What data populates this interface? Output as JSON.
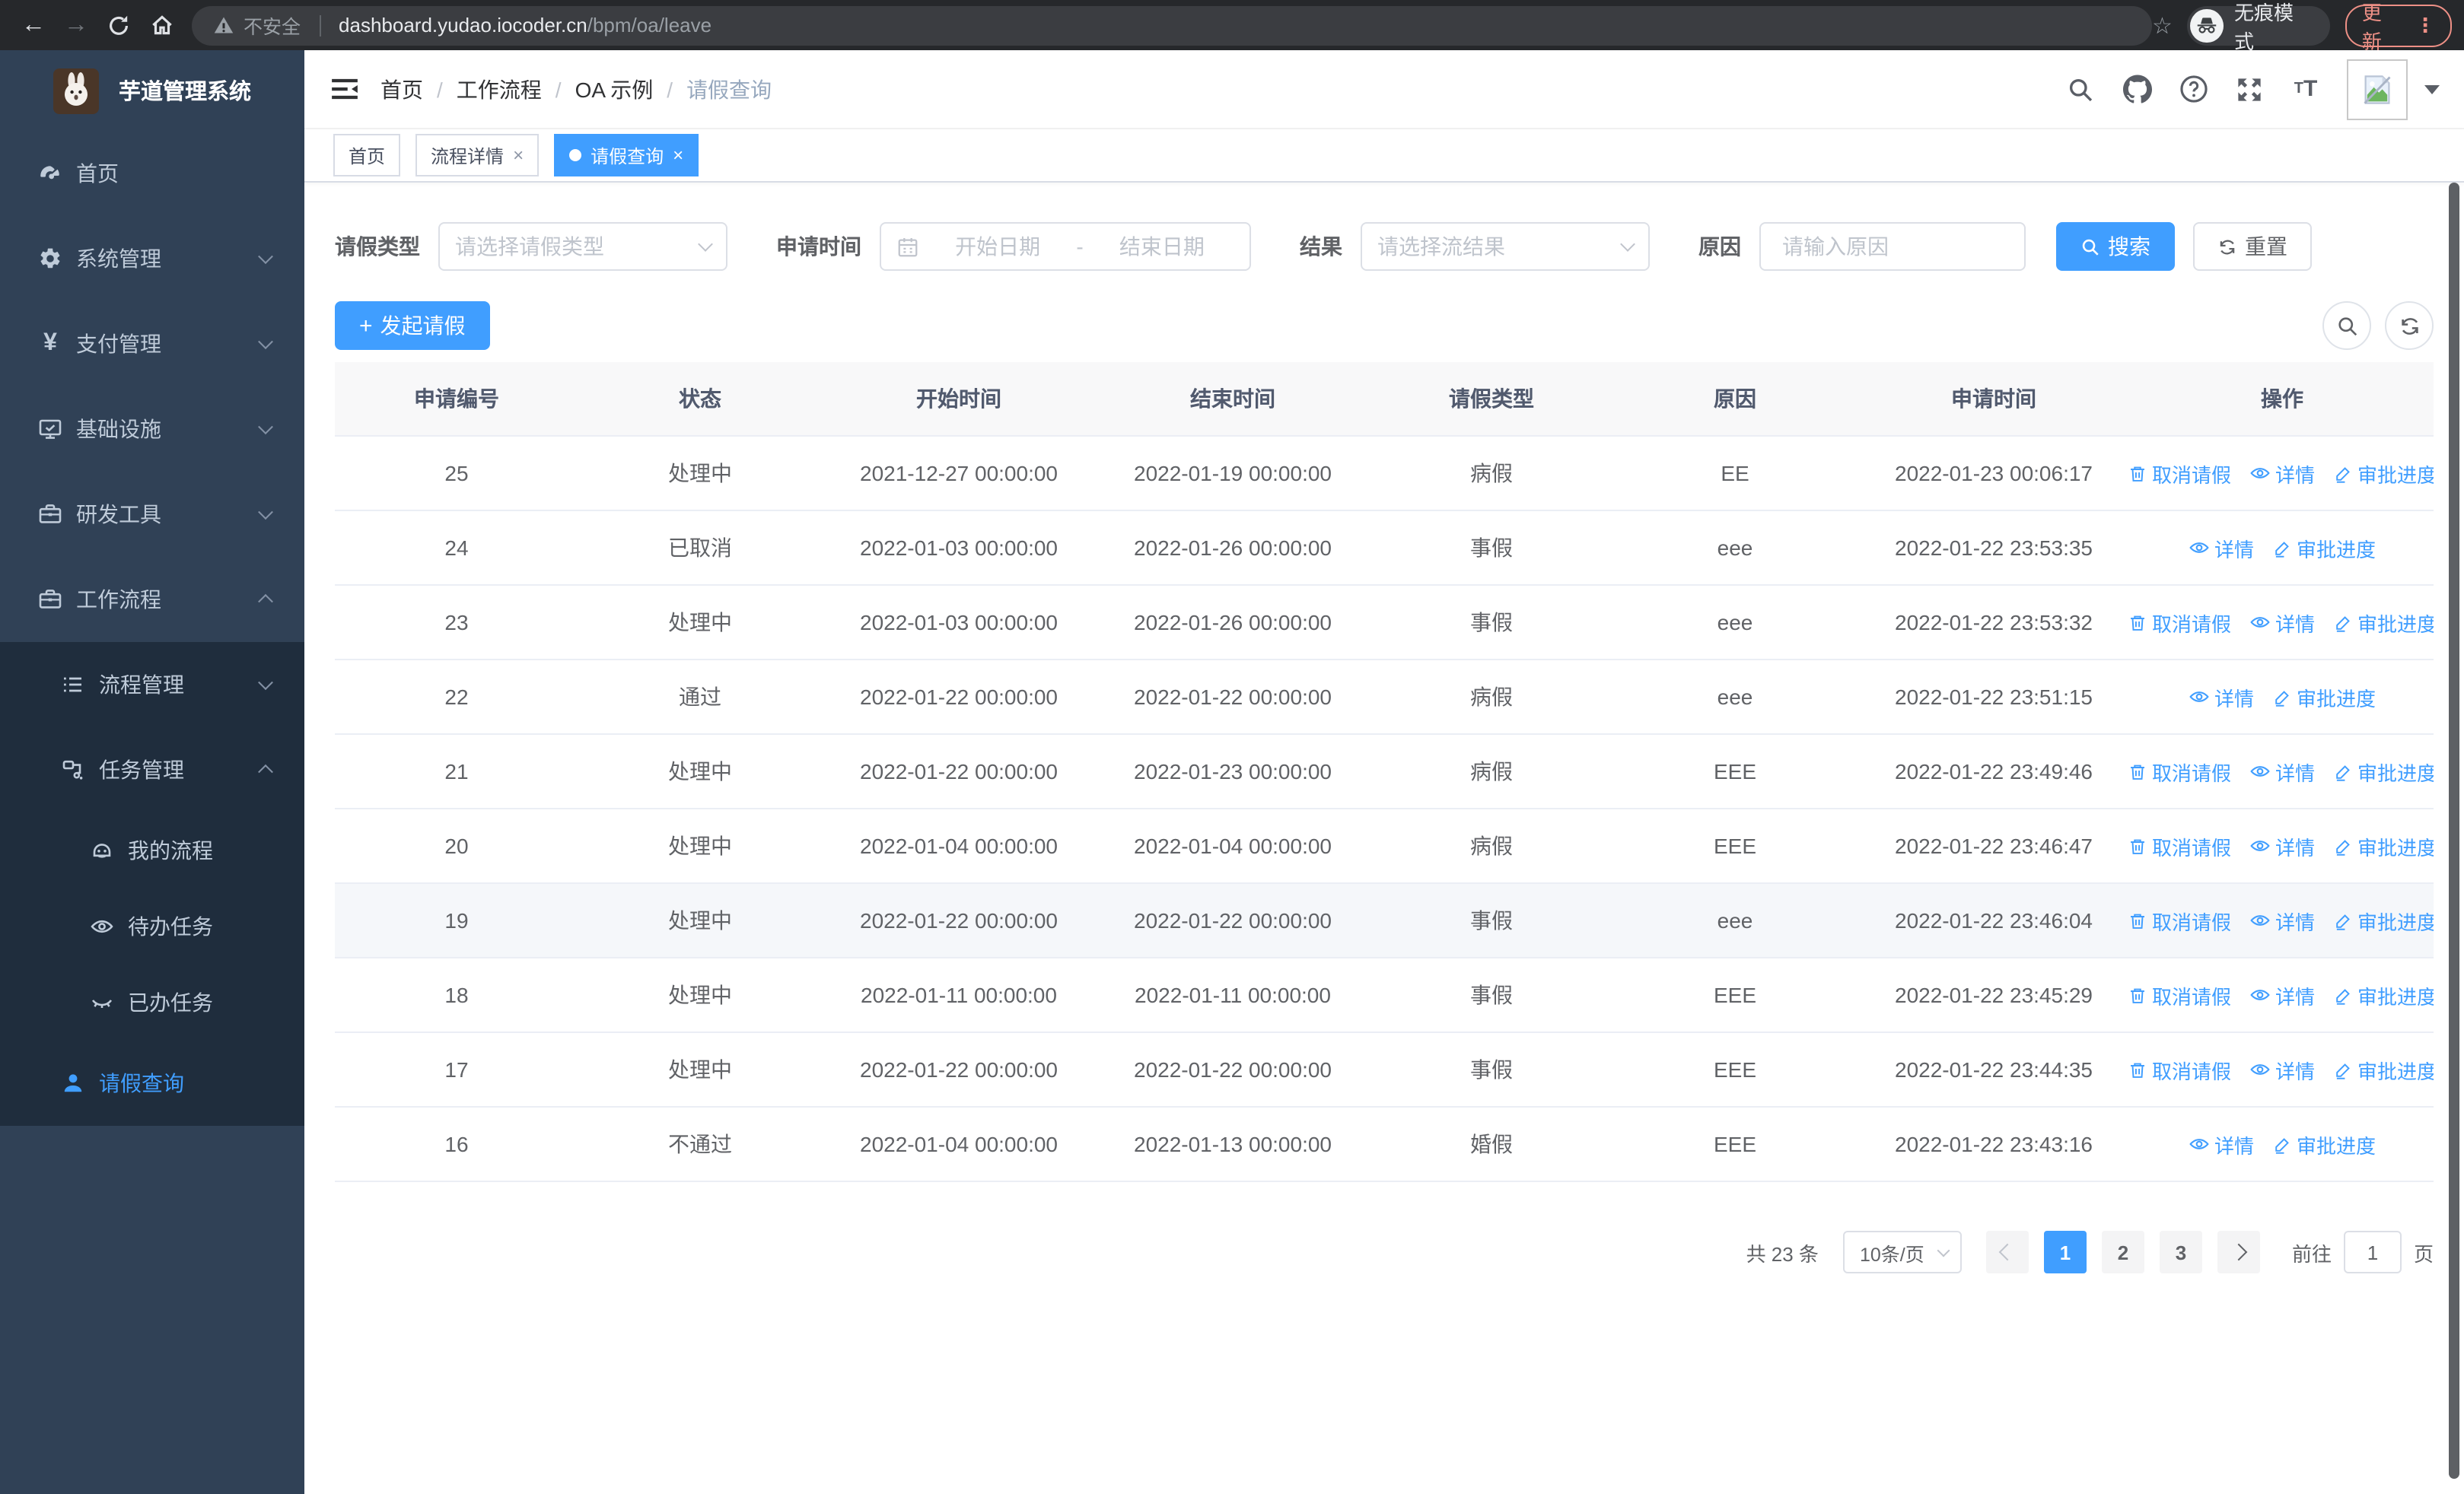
{
  "browser": {
    "security_label": "不安全",
    "url_host": "dashboard.yudao.iocoder.cn",
    "url_path": "/bpm/oa/leave",
    "incognito_label": "无痕模式",
    "update_label": "更新"
  },
  "sidebar": {
    "title": "芋道管理系统",
    "home": "首页",
    "system": "系统管理",
    "payment": "支付管理",
    "infra": "基础设施",
    "devtools": "研发工具",
    "workflow": "工作流程",
    "process_mgmt": "流程管理",
    "task_mgmt": "任务管理",
    "my_process": "我的流程",
    "todo_task": "待办任务",
    "done_task": "已办任务",
    "leave_query": "请假查询"
  },
  "navbar": {
    "breadcrumb": [
      "首页",
      "工作流程",
      "OA 示例",
      "请假查询"
    ]
  },
  "tags": {
    "t1": "首页",
    "t2": "流程详情",
    "t3": "请假查询",
    "close": "×"
  },
  "filters": {
    "type_label": "请假类型",
    "type_placeholder": "请选择请假类型",
    "time_label": "申请时间",
    "start_placeholder": "开始日期",
    "range_separator": "-",
    "end_placeholder": "结束日期",
    "result_label": "结果",
    "result_placeholder": "请选择流结果",
    "reason_label": "原因",
    "reason_placeholder": "请输入原因",
    "search_label": "搜索",
    "reset_label": "重置"
  },
  "toolbar": {
    "create_label": "发起请假"
  },
  "table": {
    "columns": [
      "申请编号",
      "状态",
      "开始时间",
      "结束时间",
      "请假类型",
      "原因",
      "申请时间",
      "操作"
    ],
    "actions": {
      "cancel": "取消请假",
      "detail": "详情",
      "progress": "审批进度"
    },
    "rows": [
      {
        "id": "25",
        "status": "处理中",
        "start": "2021-12-27 00:00:00",
        "end": "2022-01-19 00:00:00",
        "type": "病假",
        "reason": "EE",
        "applied": "2022-01-23 00:06:17",
        "cancellable": true
      },
      {
        "id": "24",
        "status": "已取消",
        "start": "2022-01-03 00:00:00",
        "end": "2022-01-26 00:00:00",
        "type": "事假",
        "reason": "eee",
        "applied": "2022-01-22 23:53:35",
        "cancellable": false
      },
      {
        "id": "23",
        "status": "处理中",
        "start": "2022-01-03 00:00:00",
        "end": "2022-01-26 00:00:00",
        "type": "事假",
        "reason": "eee",
        "applied": "2022-01-22 23:53:32",
        "cancellable": true
      },
      {
        "id": "22",
        "status": "通过",
        "start": "2022-01-22 00:00:00",
        "end": "2022-01-22 00:00:00",
        "type": "病假",
        "reason": "eee",
        "applied": "2022-01-22 23:51:15",
        "cancellable": false
      },
      {
        "id": "21",
        "status": "处理中",
        "start": "2022-01-22 00:00:00",
        "end": "2022-01-23 00:00:00",
        "type": "病假",
        "reason": "EEE",
        "applied": "2022-01-22 23:49:46",
        "cancellable": true
      },
      {
        "id": "20",
        "status": "处理中",
        "start": "2022-01-04 00:00:00",
        "end": "2022-01-04 00:00:00",
        "type": "病假",
        "reason": "EEE",
        "applied": "2022-01-22 23:46:47",
        "cancellable": true
      },
      {
        "id": "19",
        "status": "处理中",
        "start": "2022-01-22 00:00:00",
        "end": "2022-01-22 00:00:00",
        "type": "事假",
        "reason": "eee",
        "applied": "2022-01-22 23:46:04",
        "cancellable": true,
        "highlight": true
      },
      {
        "id": "18",
        "status": "处理中",
        "start": "2022-01-11 00:00:00",
        "end": "2022-01-11 00:00:00",
        "type": "事假",
        "reason": "EEE",
        "applied": "2022-01-22 23:45:29",
        "cancellable": true
      },
      {
        "id": "17",
        "status": "处理中",
        "start": "2022-01-22 00:00:00",
        "end": "2022-01-22 00:00:00",
        "type": "事假",
        "reason": "EEE",
        "applied": "2022-01-22 23:44:35",
        "cancellable": true
      },
      {
        "id": "16",
        "status": "不通过",
        "start": "2022-01-04 00:00:00",
        "end": "2022-01-13 00:00:00",
        "type": "婚假",
        "reason": "EEE",
        "applied": "2022-01-22 23:43:16",
        "cancellable": false
      }
    ]
  },
  "pagination": {
    "total": "共 23 条",
    "page_size": "10条/页",
    "pages": [
      "1",
      "2",
      "3"
    ],
    "current": "1",
    "goto_label": "前往",
    "goto_value": "1",
    "unit_label": "页"
  },
  "colors": {
    "primary": "#409eff",
    "sidebar_bg": "#304156",
    "submenu_bg": "#1f2d3d",
    "update_accent": "#ee9086"
  }
}
